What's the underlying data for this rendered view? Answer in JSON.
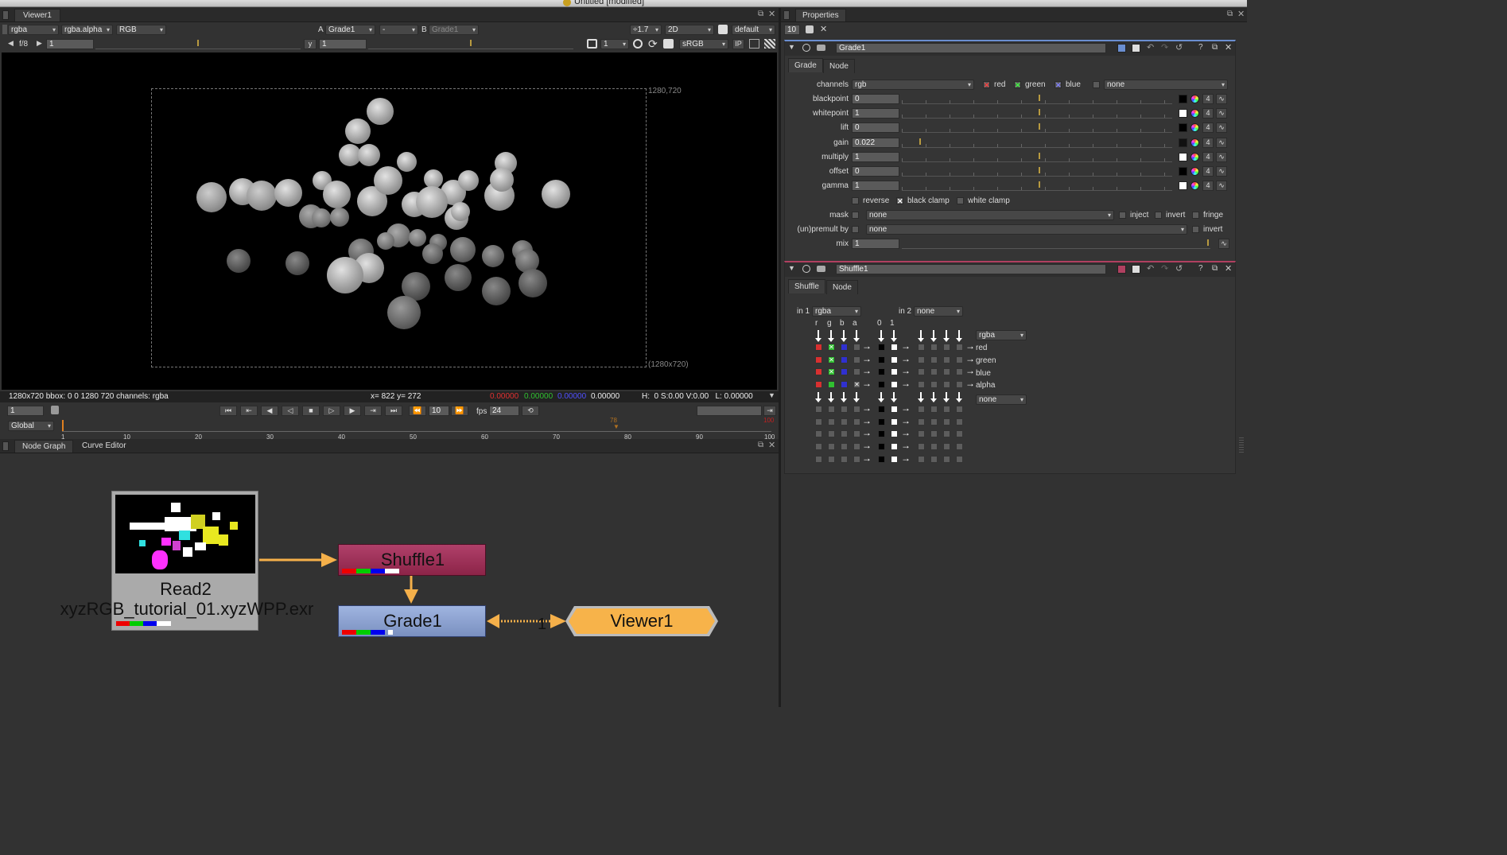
{
  "window": {
    "title": "Untitled [modified]"
  },
  "viewer": {
    "tab": "Viewer1",
    "channels": "rgba",
    "alpha_channel": "rgba.alpha",
    "display_mode": "RGB",
    "a_label": "A",
    "a_input": "Grade1",
    "wipe_op": "-",
    "b_label": "B",
    "b_input": "Grade1",
    "zoom": "÷1.7",
    "view_mode": "2D",
    "lut": "default",
    "fstop": "f/8",
    "frame_field": "1",
    "y_label": "y",
    "y_field": "1",
    "proxy_value": "1",
    "colorspace": "sRGB",
    "ip_label": "IP",
    "format_top": "1280,720",
    "format_bottom": "(1280x720)",
    "info_left": "1280x720 bbox: 0 0 1280 720 channels: rgba",
    "info_xy": "x= 822 y= 272",
    "info_r": "0.00000",
    "info_g": "0.00000",
    "info_b": "0.00000",
    "info_a": "0.00000",
    "info_hsv": "H:  0 S:0.00 V:0.00   L: 0.00000",
    "colors": {
      "r": "#e03030",
      "g": "#30c030",
      "b": "#4040ff"
    }
  },
  "timeline": {
    "frame": "1",
    "step": "10",
    "fps_label": "fps",
    "fps": "24",
    "scope": "Global",
    "ticks": [
      "1",
      "10",
      "20",
      "30",
      "40",
      "50",
      "60",
      "70",
      "80",
      "90",
      "100"
    ],
    "current_marker": "78",
    "end_marker": "100"
  },
  "nodegraph": {
    "tabs": [
      "Node Graph",
      "Curve Editor"
    ],
    "read_node": {
      "title": "Read2",
      "file": "xyzRGB_tutorial_01.xyzWPP.exr"
    },
    "shuffle_node": {
      "title": "Shuffle1"
    },
    "grade_node": {
      "title": "Grade1"
    },
    "viewer_node": {
      "title": "Viewer1"
    },
    "pipe_number": "1"
  },
  "properties": {
    "tab": "Properties",
    "max_panels": "10",
    "grade": {
      "name": "Grade1",
      "tabs": [
        "Grade",
        "Node"
      ],
      "channels_label": "channels",
      "channels": "rgb",
      "ch_red": "red",
      "ch_green": "green",
      "ch_blue": "blue",
      "ch_extra": "none",
      "rows": [
        {
          "label": "blackpoint",
          "value": "0"
        },
        {
          "label": "whitepoint",
          "value": "1"
        },
        {
          "label": "lift",
          "value": "0"
        },
        {
          "label": "gain",
          "value": "0.022"
        },
        {
          "label": "multiply",
          "value": "1"
        },
        {
          "label": "offset",
          "value": "0"
        },
        {
          "label": "gamma",
          "value": "1"
        }
      ],
      "btn_four": "4",
      "reverse": "reverse",
      "black_clamp": "black clamp",
      "white_clamp": "white clamp",
      "mask_label": "mask",
      "mask": "none",
      "inject": "inject",
      "invert": "invert",
      "fringe": "fringe",
      "premult_label": "(un)premult by",
      "premult": "none",
      "premult_invert": "invert",
      "mix_label": "mix",
      "mix": "1"
    },
    "shuffle": {
      "name": "Shuffle1",
      "tabs": [
        "Shuffle",
        "Node"
      ],
      "in1_label": "in 1",
      "in1": "rgba",
      "in2_label": "in 2",
      "in2": "none",
      "col_headers": [
        "r",
        "g",
        "b",
        "a"
      ],
      "const_headers": [
        "0",
        "1"
      ],
      "out1": "rgba",
      "out_labels": [
        "red",
        "green",
        "blue",
        "alpha"
      ],
      "out2": "none"
    }
  }
}
